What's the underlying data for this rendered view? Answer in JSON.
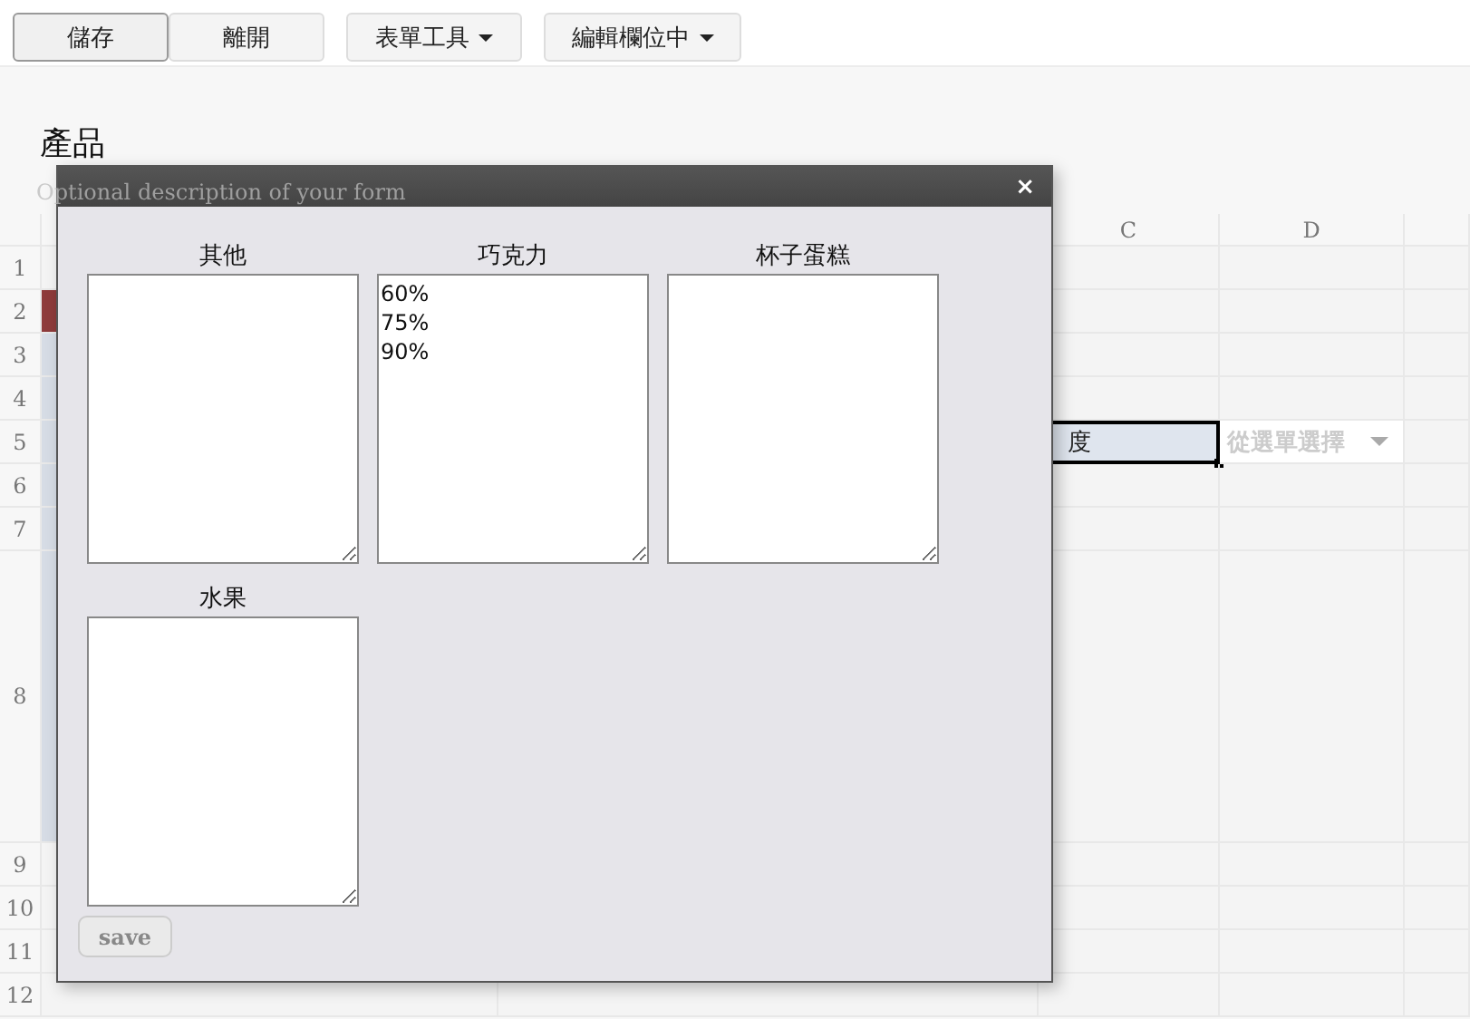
{
  "toolbar": {
    "buttons": [
      {
        "label": "儲存",
        "selected": true,
        "dropdown": false
      },
      {
        "label": "離開",
        "selected": false,
        "dropdown": false
      },
      {
        "label": "表單工具",
        "selected": false,
        "dropdown": true
      },
      {
        "label": "編輯欄位中",
        "selected": false,
        "dropdown": true
      }
    ]
  },
  "form": {
    "title": "產品",
    "description": "Optional description of your form"
  },
  "sheet": {
    "columns": [
      "C",
      "D"
    ],
    "rows": [
      {
        "number": "1",
        "kind": "normal"
      },
      {
        "number": "2",
        "kind": "normal",
        "color": "#8e3b3b"
      },
      {
        "number": "3",
        "kind": "normal",
        "color": "#d6dce5"
      },
      {
        "number": "4",
        "kind": "normal",
        "color": "#d6dce5"
      },
      {
        "number": "5",
        "kind": "normal",
        "color": "#d6dce5",
        "column_c": {
          "text": "度",
          "selected": true
        },
        "column_d": {
          "placeholder": "從選單選擇"
        }
      },
      {
        "number": "6",
        "kind": "normal",
        "color": "#d6dce5"
      },
      {
        "number": "7",
        "kind": "normal",
        "color": "#d6dce5"
      },
      {
        "number": "8",
        "kind": "tall",
        "color": "#d6dce5"
      },
      {
        "number": "9",
        "kind": "normal"
      },
      {
        "number": "10",
        "kind": "normal"
      },
      {
        "number": "11",
        "kind": "normal"
      },
      {
        "number": "12",
        "kind": "normal"
      }
    ]
  },
  "dialog": {
    "close": "×",
    "fields": [
      {
        "label": "其他"
      },
      {
        "label": "巧克力",
        "value": "60%\n75%\n90%"
      },
      {
        "label": "杯子蛋糕"
      },
      {
        "label": "水果"
      }
    ],
    "save_button": "save"
  }
}
